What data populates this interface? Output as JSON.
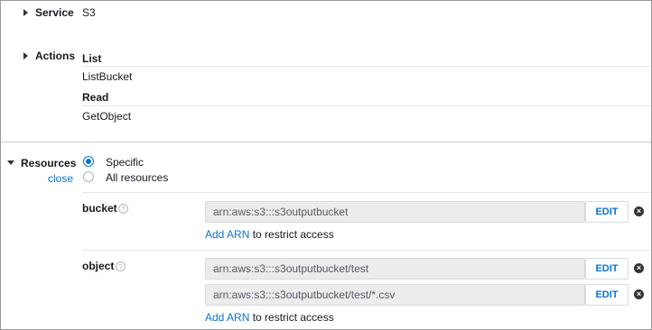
{
  "service": {
    "label": "Service",
    "value": "S3"
  },
  "actions": {
    "label": "Actions",
    "groups": [
      {
        "heading": "List",
        "item": "ListBucket"
      },
      {
        "heading": "Read",
        "item": "GetObject"
      }
    ]
  },
  "resources": {
    "label": "Resources",
    "close_link": "close",
    "options": [
      {
        "label": "Specific",
        "selected": true
      },
      {
        "label": "All resources",
        "selected": false
      }
    ],
    "bucket": {
      "label": "bucket",
      "help": "?",
      "arns": [
        "arn:aws:s3:::s3outputbucket"
      ]
    },
    "object": {
      "label": "object",
      "help": "?",
      "arns": [
        "arn:aws:s3:::s3outputbucket/test",
        "arn:aws:s3:::s3outputbucket/test/*.csv"
      ]
    },
    "edit_label": "EDIT",
    "remove_glyph": "×",
    "add_arn_link": "Add ARN",
    "add_arn_suffix": "to restrict access"
  },
  "colors": {
    "link": "#0972d3",
    "field_bg": "#ececec",
    "border": "#d5dbdb"
  }
}
